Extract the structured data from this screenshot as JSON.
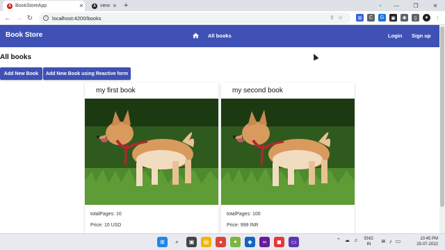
{
  "browser": {
    "tabs": [
      {
        "title": "BookStoreApp",
        "active": true
      },
      {
        "title": "view -",
        "active": false
      }
    ],
    "new_tab_label": "+",
    "url": "localhost:4200/books",
    "window_controls": {
      "minimize": "—",
      "restore": "❐",
      "close": "✕"
    }
  },
  "app": {
    "brand": "Book Store",
    "nav_center_link": "All books",
    "nav_right": {
      "login": "Login",
      "signup": "Sign up"
    },
    "accent_color": "#3f51b5"
  },
  "page": {
    "title": "All books",
    "buttons": {
      "add_new": "Add New Book",
      "add_reactive": "Add New Book using Reactive form"
    },
    "books": [
      {
        "title": "my first book",
        "total_pages_label": "totalPages: 10",
        "price_label": "Price: 10 USD"
      },
      {
        "title": "my second book",
        "total_pages_label": "totalPages: 100",
        "price_label": "Price: 999 INR"
      }
    ]
  },
  "taskbar": {
    "lang": "ENG",
    "region": "IN",
    "time": "10:45 PM",
    "date": "25-07-2022"
  }
}
